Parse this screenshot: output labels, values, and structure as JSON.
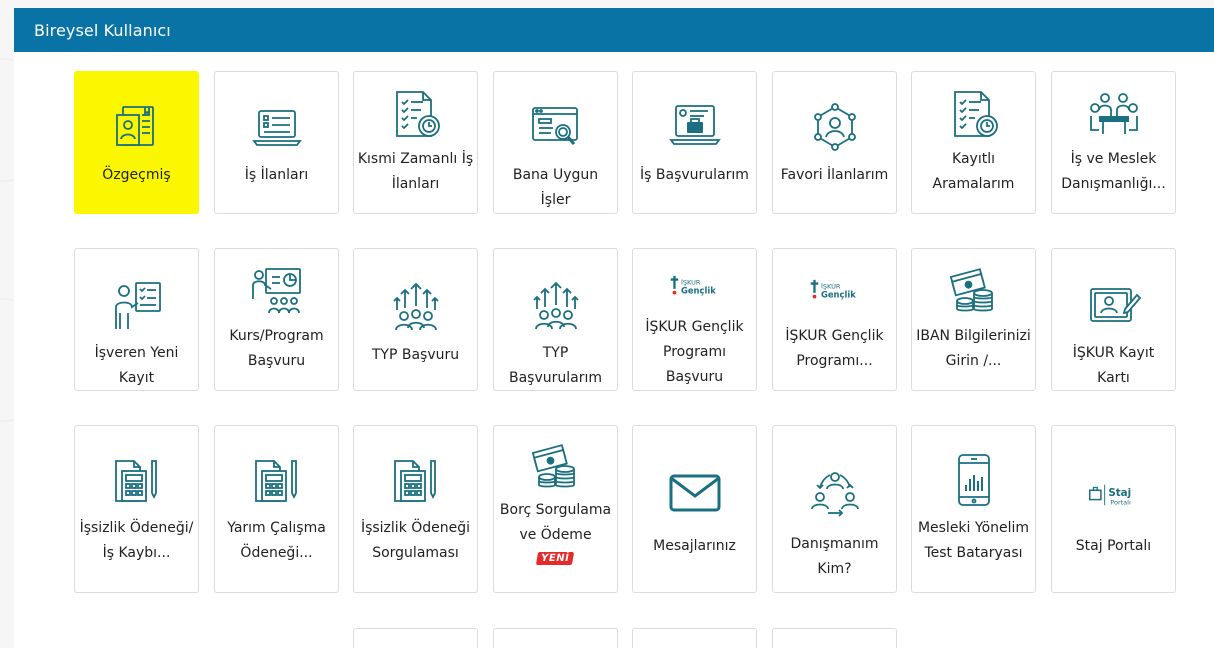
{
  "header": {
    "title": "Bireysel Kullanıcı"
  },
  "colors": {
    "header_bg": "#0a73a6",
    "icon": "#1a6f80",
    "highlight": "#fbf700",
    "badge": "#e52a2a"
  },
  "rows": [
    [
      {
        "label": "Özgeçmiş",
        "icon": "resume-icon"
      },
      {
        "label": "İş İlanları",
        "icon": "laptop-checklist-icon"
      },
      {
        "label": "Kısmi Zamanlı İş İlanları",
        "icon": "document-clock-icon"
      },
      {
        "label": "Bana Uygun İşler",
        "icon": "browser-search-icon"
      },
      {
        "label": "İş Başvurularım",
        "icon": "laptop-briefcase-icon"
      },
      {
        "label": "Favori İlanlarım",
        "icon": "network-person-icon"
      },
      {
        "label": "Kayıtlı Aramalarım",
        "icon": "document-clock-icon"
      },
      {
        "label": "İş ve Meslek Danışmanlığı...",
        "icon": "meeting-table-icon"
      }
    ],
    [
      {
        "label": "İşveren Yeni Kayıt",
        "icon": "presenter-board-icon"
      },
      {
        "label": "Kurs/Program Başvuru",
        "icon": "training-chart-icon"
      },
      {
        "label": "TYP Başvuru",
        "icon": "group-growth-icon"
      },
      {
        "label": "TYP Başvurularım",
        "icon": "group-growth-icon"
      },
      {
        "label": "İŞKUR Gençlik Programı Başvuru",
        "icon": "iskur-genclik-logo"
      },
      {
        "label": "İŞKUR Gençlik Programı...",
        "icon": "iskur-genclik-logo"
      },
      {
        "label": "IBAN Bilgilerinizi Girin /...",
        "icon": "money-coins-icon"
      },
      {
        "label": "İŞKUR Kayıt Kartı",
        "icon": "id-card-pen-icon"
      }
    ],
    [
      {
        "label": "İşsizlik Ödeneği/ İş Kaybı...",
        "icon": "calculator-doc-icon"
      },
      {
        "label": "Yarım Çalışma Ödeneği...",
        "icon": "calculator-doc-icon"
      },
      {
        "label": "İşsizlik Ödeneği Sorgulaması",
        "icon": "calculator-doc-icon"
      },
      {
        "label": "Borç Sorgulama ve Ödeme",
        "icon": "money-coins-icon",
        "badge": "YENİ"
      },
      {
        "label": "Mesajlarınız",
        "icon": "envelope-icon"
      },
      {
        "label": "Danışmanım Kim?",
        "icon": "people-cycle-icon"
      },
      {
        "label": "Mesleki Yönelim Test Bataryası",
        "icon": "smartphone-chart-icon"
      },
      {
        "label": "Staj Portalı",
        "icon": "staj-portal-logo"
      }
    ]
  ],
  "logos": {
    "iskur_top": "İŞKUR",
    "genclik": "Gençlik",
    "staj": "Staj",
    "portali": "Portalı"
  }
}
